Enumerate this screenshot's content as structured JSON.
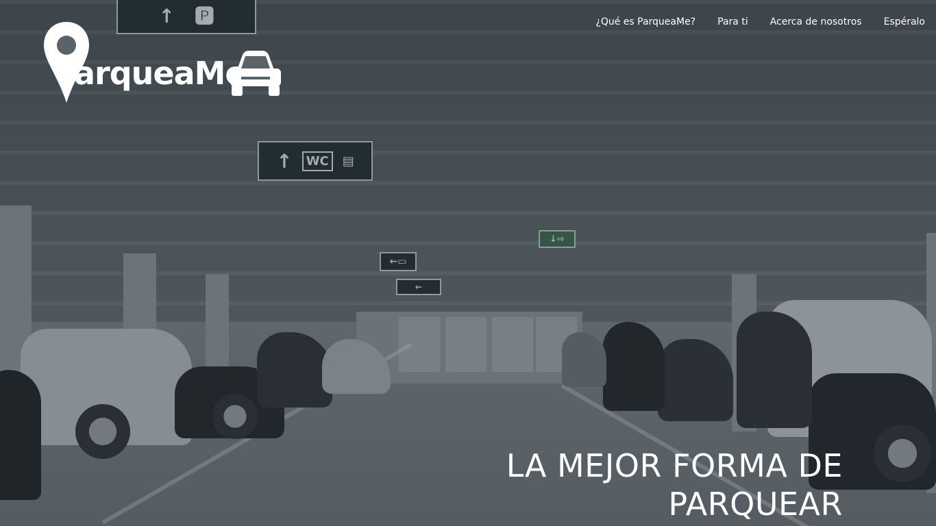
{
  "brand": {
    "name": "ParqueaMe",
    "wordmark_text": "arqueaMe"
  },
  "nav": {
    "items": [
      {
        "label": "¿Qué es ParqueaMe?"
      },
      {
        "label": "Para ti"
      },
      {
        "label": "Acerca de nosotros"
      },
      {
        "label": "Espéralo"
      }
    ]
  },
  "hero": {
    "headline_line1": "LA MEJOR FORMA DE",
    "headline_line2": "PARQUEAR",
    "background": "parking-garage-photo"
  },
  "signs": {
    "wc": "WC"
  },
  "colors": {
    "text": "#ffffff",
    "overlay": "#283238"
  }
}
